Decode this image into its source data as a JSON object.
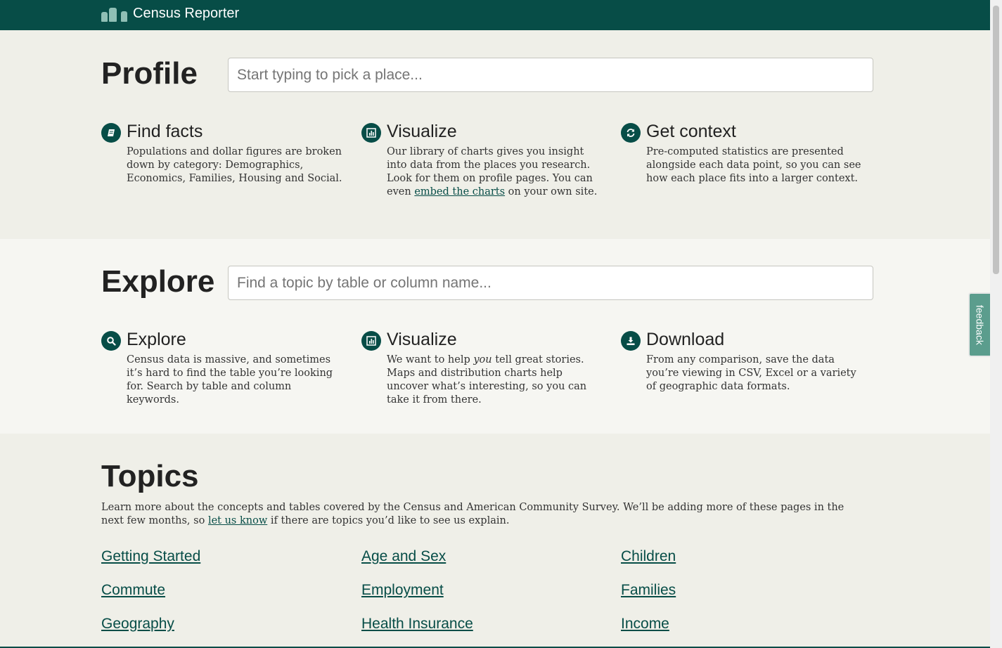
{
  "header": {
    "brand": "Census Reporter"
  },
  "profile": {
    "title": "Profile",
    "search_placeholder": "Start typing to pick a place...",
    "features": [
      {
        "icon": "book-icon",
        "title": "Find facts",
        "text": "Populations and dollar figures are broken down by category: Demographics, Economics, Families, Housing and Social."
      },
      {
        "icon": "bar-chart-icon",
        "title": "Visualize",
        "text_before": "Our library of charts gives you insight into data from the places you research. Look for them on profile pages. You can even ",
        "link": "embed the charts",
        "text_after": " on your own site."
      },
      {
        "icon": "refresh-icon",
        "title": "Get context",
        "text": "Pre-computed statistics are presented alongside each data point, so you can see how each place fits into a larger context."
      }
    ]
  },
  "explore": {
    "title": "Explore",
    "search_placeholder": "Find a topic by table or column name...",
    "features": [
      {
        "icon": "search-icon",
        "title": "Explore",
        "text": "Census data is massive, and sometimes it’s hard to find the table you’re looking for. Search by table and column keywords."
      },
      {
        "icon": "bar-chart-icon",
        "title": "Visualize",
        "text_before": "We want to help ",
        "emphasis": "you",
        "text_after": " tell great stories. Maps and distribution charts help uncover what’s interesting, so you can take it from there."
      },
      {
        "icon": "download-icon",
        "title": "Download",
        "text": "From any comparison, save the data you’re viewing in CSV, Excel or a variety of geographic data formats."
      }
    ]
  },
  "topics": {
    "title": "Topics",
    "intro_before": "Learn more about the concepts and tables covered by the Census and American Community Survey. We’ll be adding more of these pages in the next few months, so ",
    "intro_link": "let us know",
    "intro_after": " if there are topics you’d like to see us explain.",
    "links": [
      "Getting Started",
      "Age and Sex",
      "Children",
      "Commute",
      "Employment",
      "Families",
      "Geography",
      "Health Insurance",
      "Income"
    ]
  },
  "feedback": {
    "label": "feedback"
  },
  "colors": {
    "brand": "#074d47",
    "feedback": "#5b9d8d"
  }
}
